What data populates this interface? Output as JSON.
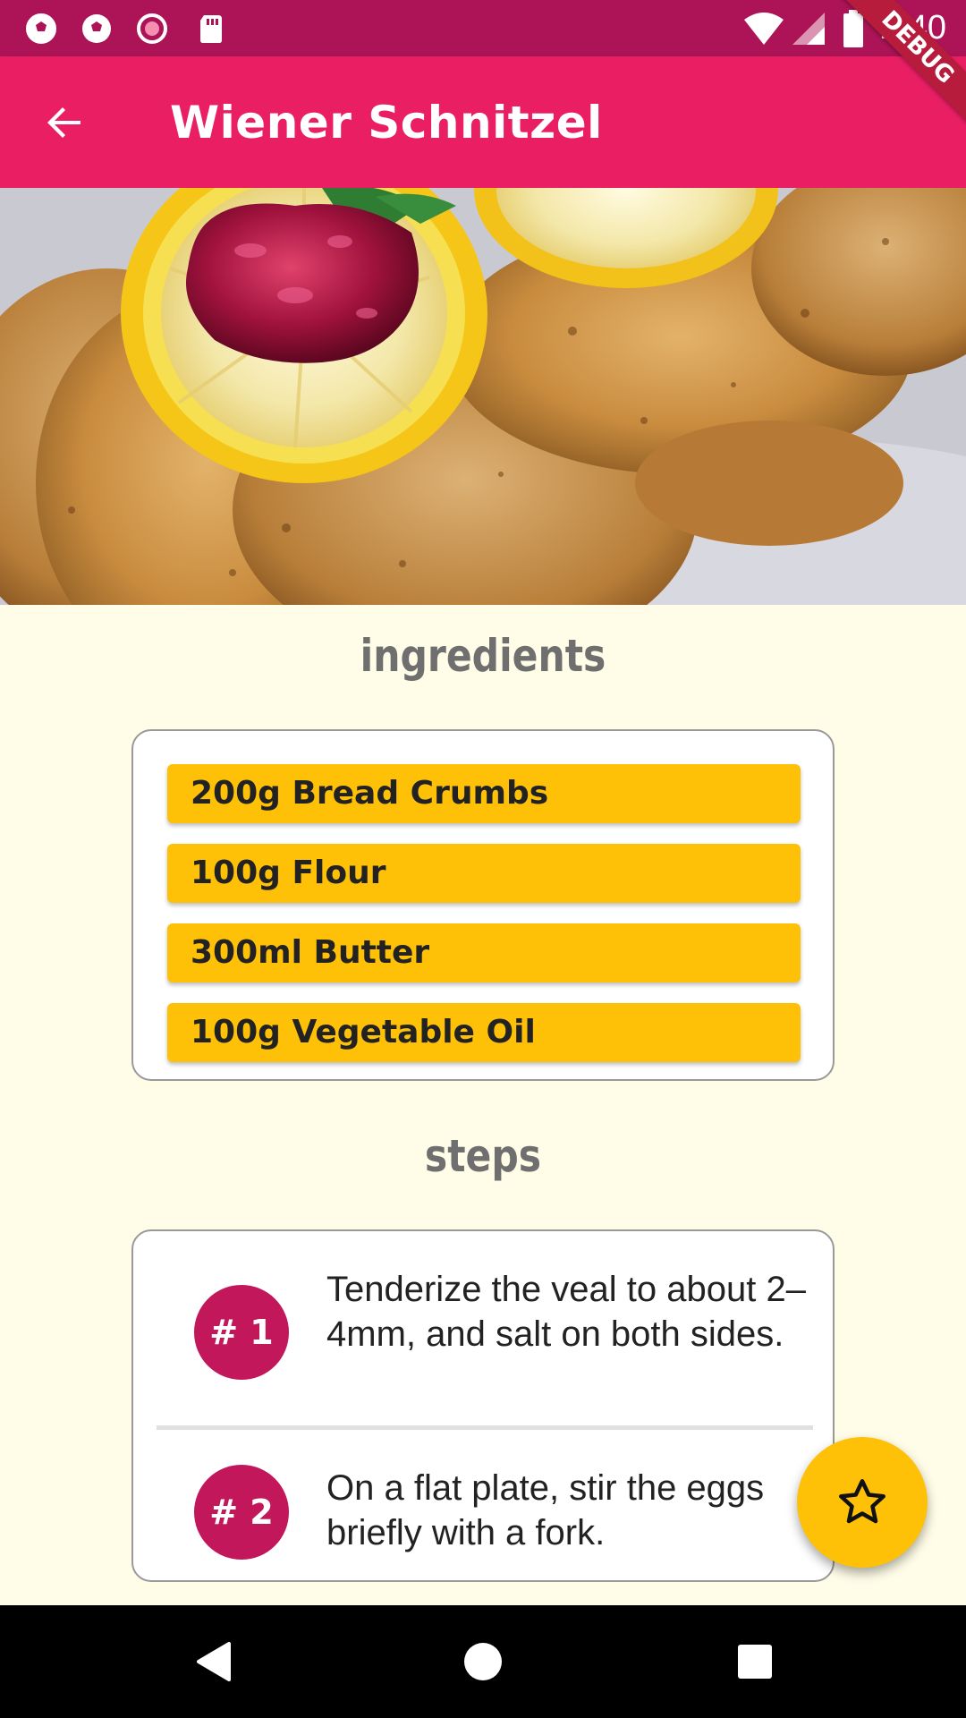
{
  "status_bar": {
    "time": "2:40",
    "left_icons": [
      "soccer-ball-icon",
      "soccer-ball-icon",
      "record-icon",
      "sd-card-icon"
    ],
    "right_icons": [
      "wifi-icon",
      "signal-icon",
      "battery-icon"
    ]
  },
  "debug_banner": "DEBUG",
  "app_bar": {
    "title": "Wiener Schnitzel",
    "back_icon": "arrow-back-icon",
    "color": "#e91e63"
  },
  "hero": {
    "subject": "Wiener Schnitzel with lemon slices and cranberry jam"
  },
  "ingredients": {
    "heading": "ingredients",
    "items": [
      {
        "label": "200g Bread Crumbs"
      },
      {
        "label": "100g Flour"
      },
      {
        "label": "300ml Butter"
      },
      {
        "label": "100g Vegetable Oil"
      }
    ]
  },
  "steps": {
    "heading": "steps",
    "items": [
      {
        "badge": "# 1",
        "text": "Tenderize the veal to about 2–4mm, and salt on both sides."
      },
      {
        "badge": "# 2",
        "text": "On a flat plate, stir the eggs briefly with a fork."
      }
    ]
  },
  "fab": {
    "icon": "star-outline-icon",
    "color": "#ffc107"
  },
  "nav_bar": {
    "buttons": [
      "back-triangle-icon",
      "home-circle-icon",
      "recents-square-icon"
    ]
  },
  "colors": {
    "primary": "#e91e63",
    "primary_dark": "#ad1457",
    "accent": "#ffc107",
    "badge": "#c2185b",
    "background": "#fffde7"
  }
}
